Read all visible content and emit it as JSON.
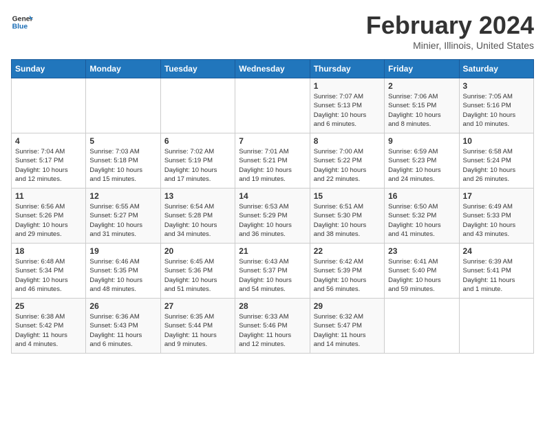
{
  "header": {
    "logo_text_general": "General",
    "logo_text_blue": "Blue",
    "month": "February 2024",
    "location": "Minier, Illinois, United States"
  },
  "weekdays": [
    "Sunday",
    "Monday",
    "Tuesday",
    "Wednesday",
    "Thursday",
    "Friday",
    "Saturday"
  ],
  "weeks": [
    [
      {
        "day": "",
        "info": ""
      },
      {
        "day": "",
        "info": ""
      },
      {
        "day": "",
        "info": ""
      },
      {
        "day": "",
        "info": ""
      },
      {
        "day": "1",
        "info": "Sunrise: 7:07 AM\nSunset: 5:13 PM\nDaylight: 10 hours\nand 6 minutes."
      },
      {
        "day": "2",
        "info": "Sunrise: 7:06 AM\nSunset: 5:15 PM\nDaylight: 10 hours\nand 8 minutes."
      },
      {
        "day": "3",
        "info": "Sunrise: 7:05 AM\nSunset: 5:16 PM\nDaylight: 10 hours\nand 10 minutes."
      }
    ],
    [
      {
        "day": "4",
        "info": "Sunrise: 7:04 AM\nSunset: 5:17 PM\nDaylight: 10 hours\nand 12 minutes."
      },
      {
        "day": "5",
        "info": "Sunrise: 7:03 AM\nSunset: 5:18 PM\nDaylight: 10 hours\nand 15 minutes."
      },
      {
        "day": "6",
        "info": "Sunrise: 7:02 AM\nSunset: 5:19 PM\nDaylight: 10 hours\nand 17 minutes."
      },
      {
        "day": "7",
        "info": "Sunrise: 7:01 AM\nSunset: 5:21 PM\nDaylight: 10 hours\nand 19 minutes."
      },
      {
        "day": "8",
        "info": "Sunrise: 7:00 AM\nSunset: 5:22 PM\nDaylight: 10 hours\nand 22 minutes."
      },
      {
        "day": "9",
        "info": "Sunrise: 6:59 AM\nSunset: 5:23 PM\nDaylight: 10 hours\nand 24 minutes."
      },
      {
        "day": "10",
        "info": "Sunrise: 6:58 AM\nSunset: 5:24 PM\nDaylight: 10 hours\nand 26 minutes."
      }
    ],
    [
      {
        "day": "11",
        "info": "Sunrise: 6:56 AM\nSunset: 5:26 PM\nDaylight: 10 hours\nand 29 minutes."
      },
      {
        "day": "12",
        "info": "Sunrise: 6:55 AM\nSunset: 5:27 PM\nDaylight: 10 hours\nand 31 minutes."
      },
      {
        "day": "13",
        "info": "Sunrise: 6:54 AM\nSunset: 5:28 PM\nDaylight: 10 hours\nand 34 minutes."
      },
      {
        "day": "14",
        "info": "Sunrise: 6:53 AM\nSunset: 5:29 PM\nDaylight: 10 hours\nand 36 minutes."
      },
      {
        "day": "15",
        "info": "Sunrise: 6:51 AM\nSunset: 5:30 PM\nDaylight: 10 hours\nand 38 minutes."
      },
      {
        "day": "16",
        "info": "Sunrise: 6:50 AM\nSunset: 5:32 PM\nDaylight: 10 hours\nand 41 minutes."
      },
      {
        "day": "17",
        "info": "Sunrise: 6:49 AM\nSunset: 5:33 PM\nDaylight: 10 hours\nand 43 minutes."
      }
    ],
    [
      {
        "day": "18",
        "info": "Sunrise: 6:48 AM\nSunset: 5:34 PM\nDaylight: 10 hours\nand 46 minutes."
      },
      {
        "day": "19",
        "info": "Sunrise: 6:46 AM\nSunset: 5:35 PM\nDaylight: 10 hours\nand 48 minutes."
      },
      {
        "day": "20",
        "info": "Sunrise: 6:45 AM\nSunset: 5:36 PM\nDaylight: 10 hours\nand 51 minutes."
      },
      {
        "day": "21",
        "info": "Sunrise: 6:43 AM\nSunset: 5:37 PM\nDaylight: 10 hours\nand 54 minutes."
      },
      {
        "day": "22",
        "info": "Sunrise: 6:42 AM\nSunset: 5:39 PM\nDaylight: 10 hours\nand 56 minutes."
      },
      {
        "day": "23",
        "info": "Sunrise: 6:41 AM\nSunset: 5:40 PM\nDaylight: 10 hours\nand 59 minutes."
      },
      {
        "day": "24",
        "info": "Sunrise: 6:39 AM\nSunset: 5:41 PM\nDaylight: 11 hours\nand 1 minute."
      }
    ],
    [
      {
        "day": "25",
        "info": "Sunrise: 6:38 AM\nSunset: 5:42 PM\nDaylight: 11 hours\nand 4 minutes."
      },
      {
        "day": "26",
        "info": "Sunrise: 6:36 AM\nSunset: 5:43 PM\nDaylight: 11 hours\nand 6 minutes."
      },
      {
        "day": "27",
        "info": "Sunrise: 6:35 AM\nSunset: 5:44 PM\nDaylight: 11 hours\nand 9 minutes."
      },
      {
        "day": "28",
        "info": "Sunrise: 6:33 AM\nSunset: 5:46 PM\nDaylight: 11 hours\nand 12 minutes."
      },
      {
        "day": "29",
        "info": "Sunrise: 6:32 AM\nSunset: 5:47 PM\nDaylight: 11 hours\nand 14 minutes."
      },
      {
        "day": "",
        "info": ""
      },
      {
        "day": "",
        "info": ""
      }
    ]
  ]
}
